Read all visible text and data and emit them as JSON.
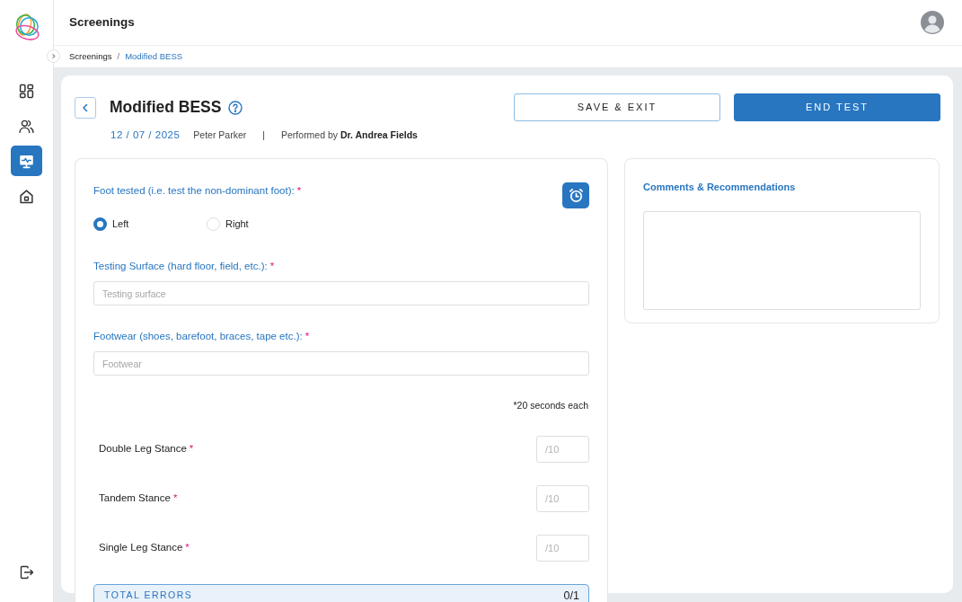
{
  "sidebar": {
    "items": [
      {
        "kind": "dashboard",
        "selected": false
      },
      {
        "kind": "people",
        "selected": false
      },
      {
        "kind": "screenings",
        "selected": true
      },
      {
        "kind": "home",
        "selected": false
      }
    ]
  },
  "header": {
    "title": "Screenings"
  },
  "breadcrumb": {
    "separator": "/",
    "items": [
      {
        "label": "Screenings",
        "selected": false
      },
      {
        "label": "Modified BESS",
        "selected": true
      }
    ]
  },
  "test": {
    "title": "Modified BESS",
    "date": "12 / 07 / 2025",
    "patient": "Peter Parker",
    "separator": "|",
    "performed_by": "Performed by **Dr. Andrea Fields**"
  },
  "buttons": [
    {
      "label": "SAVE & EXIT",
      "kind": "outline"
    },
    {
      "label": "END TEST",
      "kind": "primary"
    }
  ],
  "form": {
    "fields": [
      {
        "kind": "radio",
        "label": "Foot tested (i.e. test the non-dominant foot):",
        "required_mark": "*",
        "options": [
          {
            "label": "Left",
            "selected": true
          },
          {
            "label": "Right",
            "selected": false
          }
        ]
      },
      {
        "kind": "text",
        "label": "Testing Surface (hard floor, field, etc.):",
        "required_mark": "*",
        "placeholder": "Testing surface"
      },
      {
        "kind": "text",
        "label": "Footwear (shoes, barefoot, braces, tape etc.):",
        "required_mark": "*",
        "placeholder": "Footwear"
      }
    ],
    "note": "*20 seconds each",
    "stances": [
      {
        "label": "Double Leg Stance",
        "required_mark": "*",
        "placeholder": "/10"
      },
      {
        "label": "Tandem Stance",
        "required_mark": "*",
        "placeholder": "/10"
      },
      {
        "label": "Single Leg Stance",
        "required_mark": "*",
        "placeholder": "/10"
      }
    ],
    "total": {
      "label": "TOTAL ERRORS",
      "value": "0/1"
    }
  },
  "comments": {
    "label": "Comments & Recommendations"
  }
}
